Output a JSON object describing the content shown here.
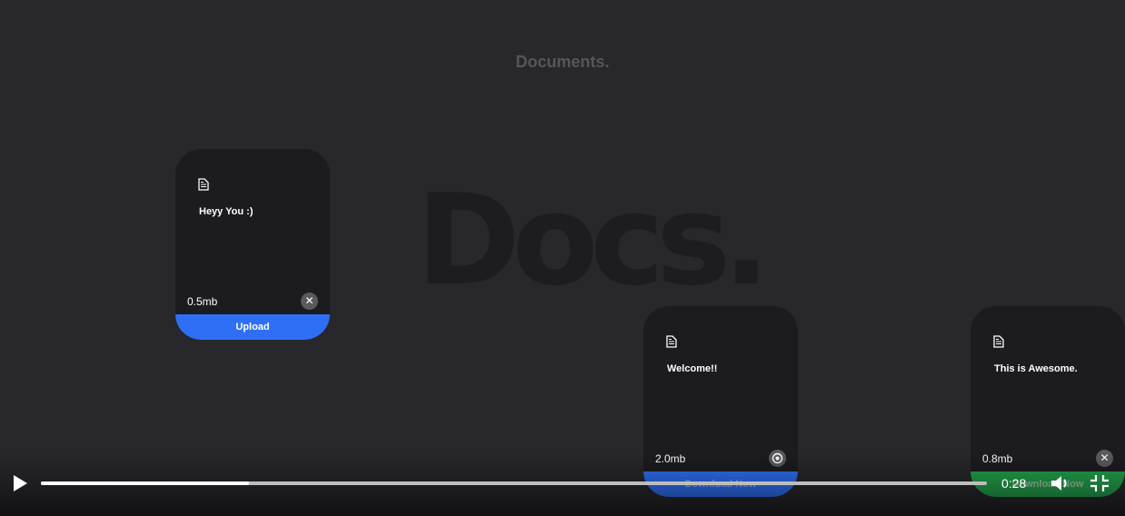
{
  "page": {
    "heading": "Documents.",
    "backdrop_word": "Docs."
  },
  "cards": [
    {
      "title": "Heyy You :)",
      "size": "0.5mb",
      "action_icon": "close-icon",
      "button_label": "Upload",
      "button_color": "#2f6ff5"
    },
    {
      "title": "Welcome!!",
      "size": "2.0mb",
      "action_icon": "download-circle-icon",
      "button_label": "Download Now",
      "button_color": "#2f6ff5"
    },
    {
      "title": "This is Awesome.",
      "size": "0.8mb",
      "action_icon": "close-icon",
      "button_label": "Download Now",
      "button_color": "#23a24d"
    }
  ],
  "video": {
    "time": "0:28",
    "progress": 0.22,
    "icons": {
      "play": "play-icon",
      "volume": "volume-icon",
      "fullscreen": "exit-fullscreen-icon"
    }
  }
}
